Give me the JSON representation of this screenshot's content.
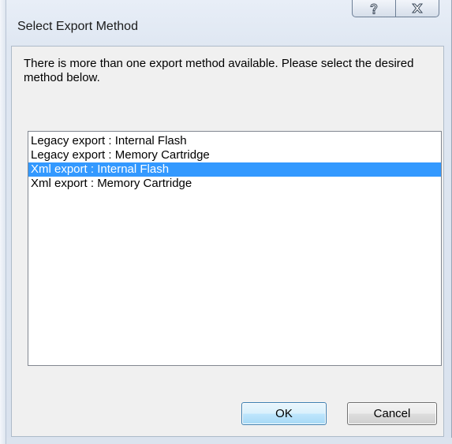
{
  "window": {
    "title": "Select Export Method"
  },
  "titlebar": {
    "help_icon": "help-question-icon",
    "close_icon": "close-x-icon"
  },
  "message": "There is more than one export method available. Please select the desired method below.",
  "export_methods": [
    {
      "label": "Legacy export : Internal Flash",
      "selected": false
    },
    {
      "label": "Legacy export : Memory Cartridge",
      "selected": false
    },
    {
      "label": "Xml export : Internal Flash",
      "selected": true
    },
    {
      "label": "Xml export : Memory Cartridge",
      "selected": false
    }
  ],
  "buttons": {
    "ok_label": "OK",
    "cancel_label": "Cancel"
  },
  "colors": {
    "selection": "#3399ff",
    "selection_text": "#ffffff"
  }
}
